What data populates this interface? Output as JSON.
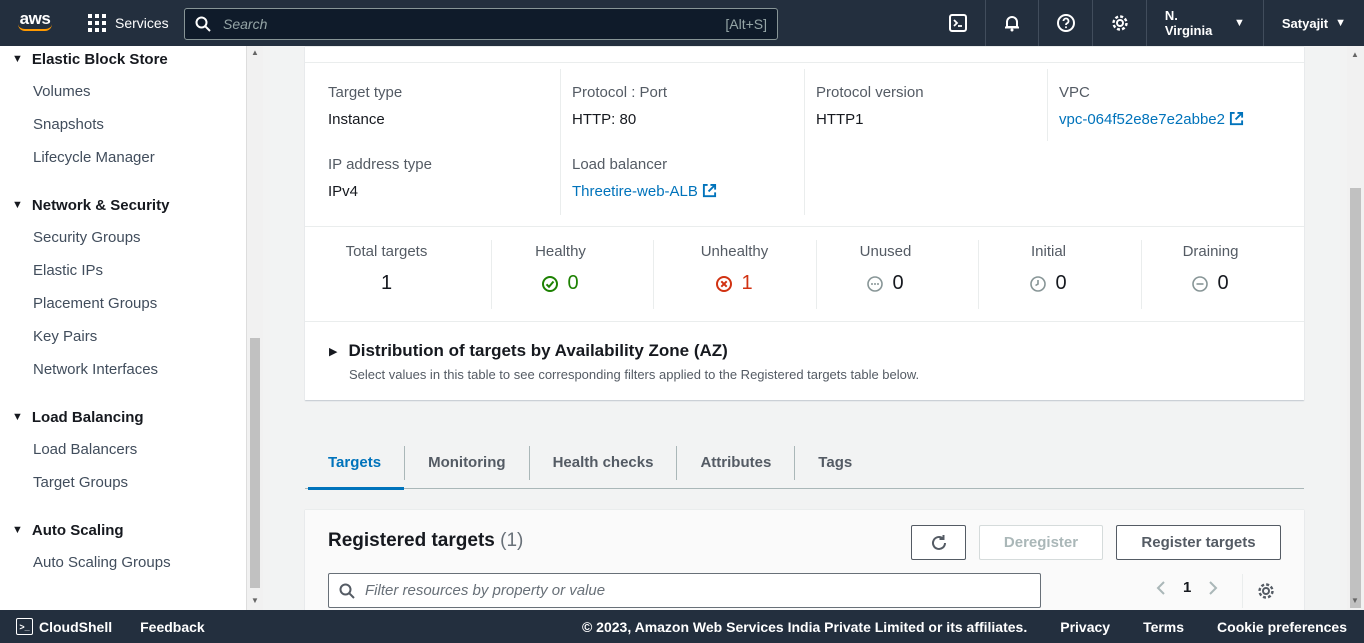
{
  "topnav": {
    "logo_text": "aws",
    "services_label": "Services",
    "search_placeholder": "Search",
    "search_shortcut": "[Alt+S]",
    "region": "N. Virginia",
    "user": "Satyajit"
  },
  "sidebar": {
    "sections": [
      {
        "title": "Elastic Block Store",
        "items": [
          "Volumes",
          "Snapshots",
          "Lifecycle Manager"
        ]
      },
      {
        "title": "Network & Security",
        "items": [
          "Security Groups",
          "Elastic IPs",
          "Placement Groups",
          "Key Pairs",
          "Network Interfaces"
        ]
      },
      {
        "title": "Load Balancing",
        "items": [
          "Load Balancers",
          "Target Groups"
        ]
      },
      {
        "title": "Auto Scaling",
        "items": [
          "Auto Scaling Groups"
        ]
      }
    ]
  },
  "details": {
    "target_type_label": "Target type",
    "target_type": "Instance",
    "protocol_port_label": "Protocol : Port",
    "protocol_port": "HTTP: 80",
    "protocol_version_label": "Protocol version",
    "protocol_version": "HTTP1",
    "vpc_label": "VPC",
    "vpc": "vpc-064f52e8e7e2abbe2",
    "ip_type_label": "IP address type",
    "ip_type": "IPv4",
    "lb_label": "Load balancer",
    "lb": "Threetire-web-ALB"
  },
  "stats": {
    "total_label": "Total targets",
    "total": "1",
    "healthy_label": "Healthy",
    "healthy": "0",
    "unhealthy_label": "Unhealthy",
    "unhealthy": "1",
    "unused_label": "Unused",
    "unused": "0",
    "initial_label": "Initial",
    "initial": "0",
    "draining_label": "Draining",
    "draining": "0"
  },
  "distribution": {
    "title": "Distribution of targets by Availability Zone (AZ)",
    "subtitle": "Select values in this table to see corresponding filters applied to the Registered targets table below."
  },
  "tabs": [
    "Targets",
    "Monitoring",
    "Health checks",
    "Attributes",
    "Tags"
  ],
  "registered": {
    "title": "Registered targets",
    "count": "(1)",
    "deregister": "Deregister",
    "register": "Register targets",
    "filter_placeholder": "Filter resources by property or value",
    "page": "1"
  },
  "footer": {
    "cloudshell": "CloudShell",
    "feedback": "Feedback",
    "copyright": "© 2023, Amazon Web Services India Private Limited or its affiliates.",
    "privacy": "Privacy",
    "terms": "Terms",
    "cookies": "Cookie preferences"
  },
  "colors": {
    "nav_bg": "#232f3e",
    "link": "#0073bb",
    "healthy": "#1d8102",
    "unhealthy": "#d13212"
  }
}
